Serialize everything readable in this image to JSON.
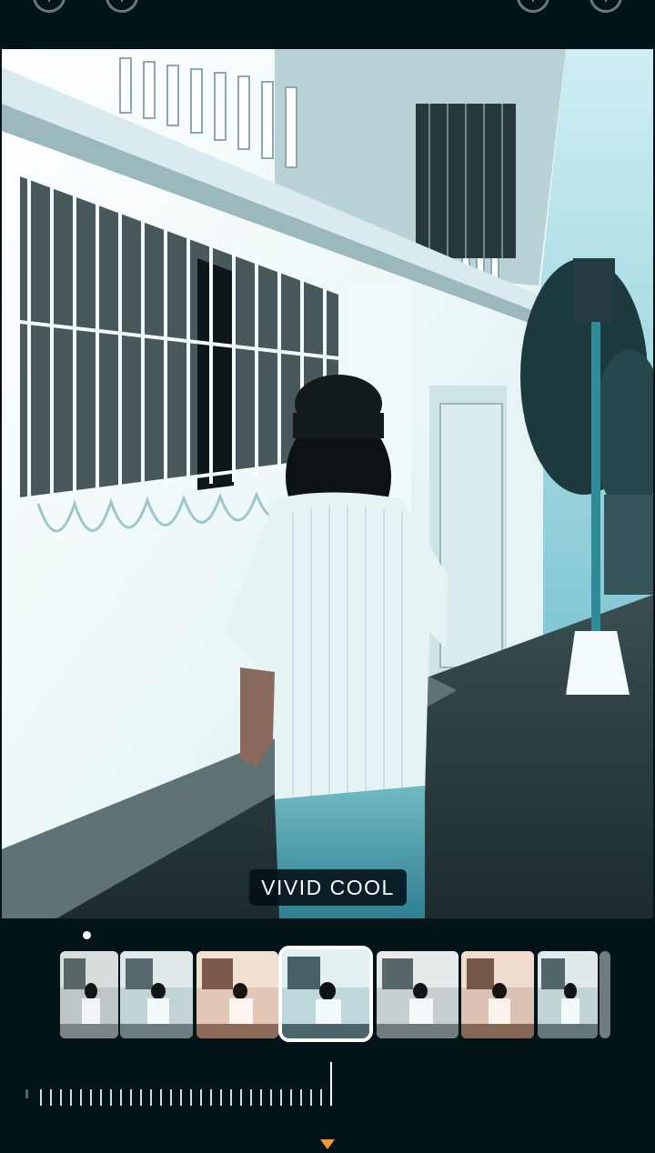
{
  "toolbar": {
    "icons": [
      "undo-icon",
      "redo-icon",
      "compare-icon",
      "check-icon"
    ]
  },
  "photo": {
    "description_icon": "photo-preview"
  },
  "filter": {
    "active_label": "VIVID COOL"
  },
  "filter_strip": {
    "selected_index": 3,
    "count": 8
  },
  "slider": {
    "value_fraction": 1.0
  },
  "colors": {
    "background": "#031419",
    "accent": "#f59a2b",
    "selected_border": "#ffffff"
  }
}
